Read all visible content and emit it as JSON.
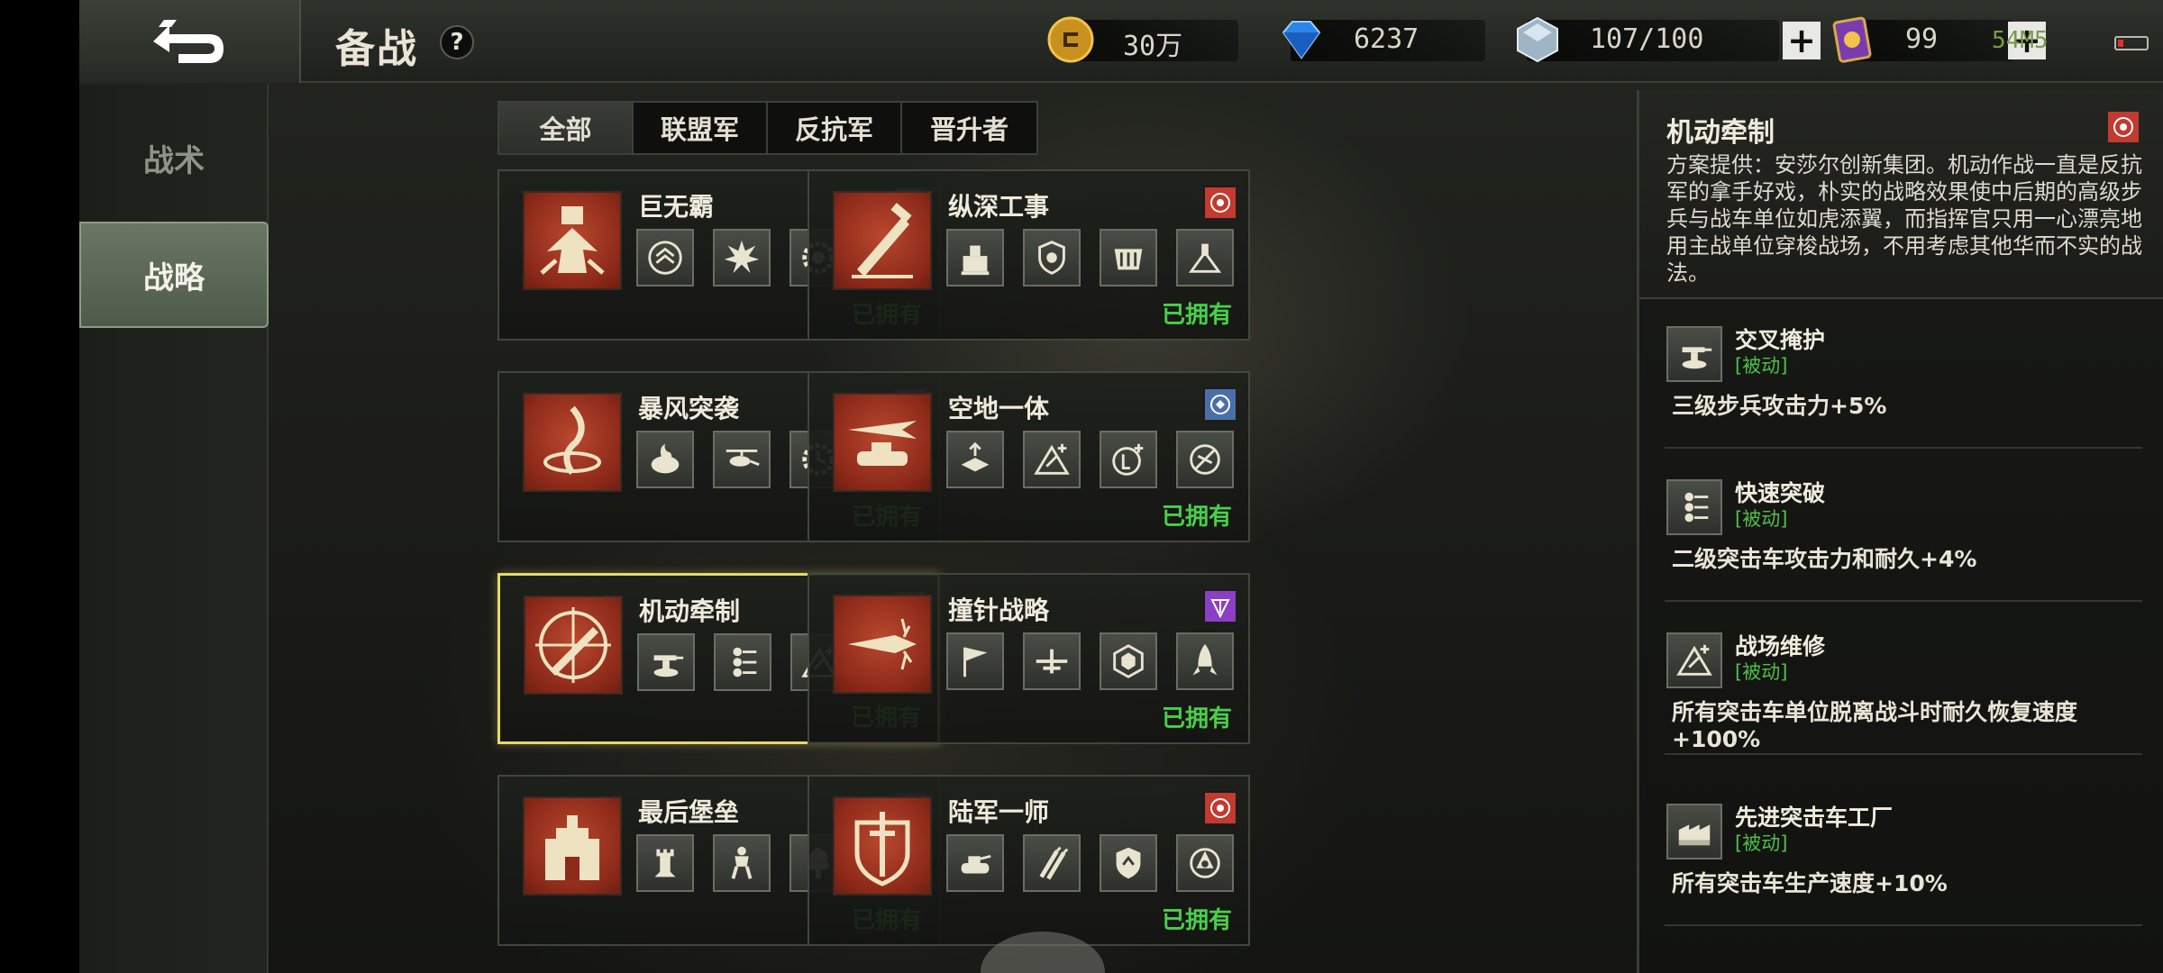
{
  "header": {
    "title": "备战",
    "help_label": "?",
    "resources": {
      "gold": "30万",
      "diamonds": "6237",
      "crystals": "107/100",
      "cards": "99"
    },
    "signal_text": "54M5",
    "battery_level": 0.1
  },
  "sidebar": {
    "items": [
      {
        "label": "战术",
        "active": false
      },
      {
        "label": "战略",
        "active": true
      }
    ]
  },
  "tabs": [
    {
      "label": "全部",
      "active": true
    },
    {
      "label": "联盟军",
      "active": false
    },
    {
      "label": "反抗军",
      "active": false
    },
    {
      "label": "晋升者",
      "active": false
    }
  ],
  "cards": [
    {
      "title": "巨无霸",
      "faction": "alliance",
      "status": "已拥有",
      "selected": false,
      "skills": [
        "chevron-rank-icon",
        "explosion-icon",
        "gear-eye-icon",
        "missile-icon"
      ]
    },
    {
      "title": "纵深工事",
      "faction": "resistance",
      "status": "已拥有",
      "selected": false,
      "skills": [
        "fortress-icon",
        "shield-badge-icon",
        "wall-icon",
        "turret-icon"
      ]
    },
    {
      "title": "暴风突袭",
      "faction": "ascendant",
      "status": "已拥有",
      "selected": false,
      "skills": [
        "fire-unit-icon",
        "helicopter-icon",
        "gear-timer-icon",
        "rank-stripes-icon"
      ]
    },
    {
      "title": "空地一体",
      "faction": "alliance",
      "status": "已拥有",
      "selected": false,
      "skills": [
        "airstrike-icon",
        "repair-plus-icon",
        "fuel-plus-icon",
        "no-air-icon"
      ]
    },
    {
      "title": "机动牵制",
      "faction": "resistance",
      "status": "已拥有",
      "selected": true,
      "skills": [
        "machine-gun-icon",
        "fast-breach-icon",
        "repair-plus-icon",
        "factory-icon"
      ]
    },
    {
      "title": "撞针战略",
      "faction": "ascendant",
      "status": "已拥有",
      "selected": false,
      "skills": [
        "flag-icon",
        "aircraft-icon",
        "hex-shield-icon",
        "rocket-icon"
      ]
    },
    {
      "title": "最后堡垒",
      "faction": "alliance",
      "status": "已拥有",
      "selected": false,
      "skills": [
        "tower-icon",
        "mech-icon",
        "tree-icon",
        "shield-chevron-icon"
      ]
    },
    {
      "title": "陆军一师",
      "faction": "resistance",
      "status": "已拥有",
      "selected": false,
      "skills": [
        "tank-icon",
        "missiles-icon",
        "shield-up-icon",
        "target-badge-icon"
      ]
    }
  ],
  "detail": {
    "title": "机动牵制",
    "faction": "resistance",
    "description": "方案提供：安莎尔创新集团。机动作战一直是反抗军的拿手好戏，朴实的战略效果使中后期的高级步兵与战车单位如虎添翼，而指挥官只用一心漂亮地用主战单位穿梭战场，不用考虑其他华而不实的战法。",
    "abilities": [
      {
        "name": "交叉掩护",
        "tag": "[被动]",
        "desc": "三级步兵攻击力+5%",
        "icon": "machine-gun-icon"
      },
      {
        "name": "快速突破",
        "tag": "[被动]",
        "desc": "二级突击车攻击力和耐久+4%",
        "icon": "fast-breach-icon"
      },
      {
        "name": "战场维修",
        "tag": "[被动]",
        "desc": "所有突击车单位脱离战斗时耐久恢复速度+100%",
        "icon": "repair-plus-icon"
      },
      {
        "name": "先进突击车工厂",
        "tag": "[被动]",
        "desc": "所有突击车生产速度+10%",
        "icon": "factory-icon"
      }
    ]
  },
  "colors": {
    "owned": "#48d048",
    "passive": "#4fbf4a",
    "selected_border": "#e6d96a",
    "emblem_red": "#a23a24",
    "alliance": "#4a6fa8",
    "resistance": "#c23a30",
    "ascendant": "#8a3fc4"
  }
}
